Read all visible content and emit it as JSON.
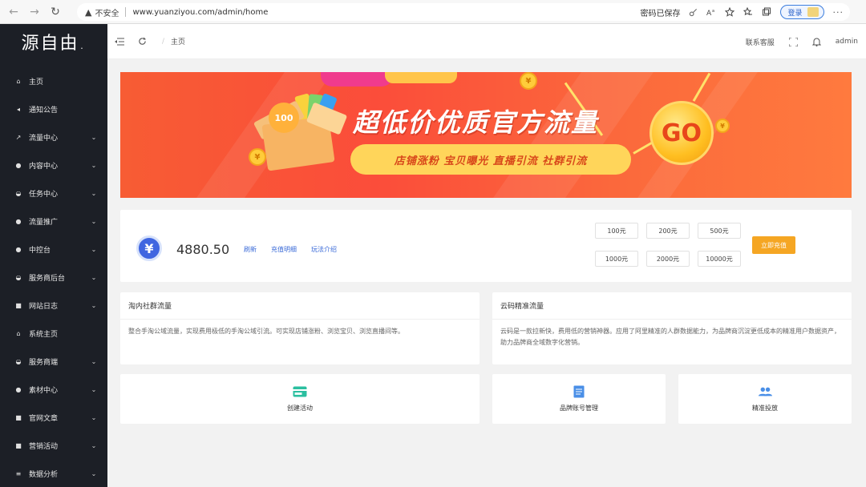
{
  "browser": {
    "back_icon": "←",
    "forward_icon": "→",
    "reload_icon": "↻",
    "security_icon": "▲",
    "security_text": "不安全",
    "url": "www.yuanziyou.com/admin/home",
    "password_saved": "密码已保存",
    "icons": [
      "key-icon",
      "read-aloud-icon",
      "favorite-add-icon",
      "favorites-icon",
      "collections-icon",
      "more-icon"
    ],
    "login_label": "登录"
  },
  "sidebar": {
    "logo": "源自由.",
    "items": [
      {
        "label": "主页",
        "icon": "home-icon",
        "glyph": "⌂",
        "chevron": false
      },
      {
        "label": "通知公告",
        "icon": "speaker-icon",
        "glyph": "◂",
        "chevron": false
      },
      {
        "label": "流量中心",
        "icon": "trend-icon",
        "glyph": "↗",
        "chevron": true
      },
      {
        "label": "内容中心",
        "icon": "content-icon",
        "glyph": "●",
        "chevron": true
      },
      {
        "label": "任务中心",
        "icon": "task-icon",
        "glyph": "◒",
        "chevron": true
      },
      {
        "label": "流量推广",
        "icon": "promote-icon",
        "glyph": "●",
        "chevron": true
      },
      {
        "label": "中控台",
        "icon": "console-icon",
        "glyph": "●",
        "chevron": true
      },
      {
        "label": "服务商后台",
        "icon": "provider-icon",
        "glyph": "◒",
        "chevron": true
      },
      {
        "label": "网站日志",
        "icon": "log-icon",
        "glyph": "■",
        "chevron": true
      },
      {
        "label": "系统主页",
        "icon": "system-home-icon",
        "glyph": "⌂",
        "chevron": false
      },
      {
        "label": "服务商端",
        "icon": "provider-end-icon",
        "glyph": "◒",
        "chevron": true
      },
      {
        "label": "素材中心",
        "icon": "material-icon",
        "glyph": "●",
        "chevron": true
      },
      {
        "label": "官网文章",
        "icon": "article-icon",
        "glyph": "■",
        "chevron": true
      },
      {
        "label": "营销活动",
        "icon": "marketing-icon",
        "glyph": "■",
        "chevron": true
      },
      {
        "label": "数据分析",
        "icon": "analytics-icon",
        "glyph": "≡",
        "chevron": true
      }
    ]
  },
  "header": {
    "breadcrumb_sep": "/",
    "breadcrumb": "主页",
    "contact": "联系客服",
    "user": "admin"
  },
  "banner": {
    "title": "超低价优质官方流量",
    "tagline": "店铺涨粉  宝贝曝光  直播引流  社群引流",
    "go": "GO",
    "coin_text": "100",
    "yen": "¥"
  },
  "balance": {
    "symbol": "¥",
    "amount": "4880.50",
    "links": [
      "刷新",
      "充值明细",
      "玩法介绍"
    ],
    "amounts_row1": [
      "100元",
      "200元",
      "500元"
    ],
    "amounts_row2": [
      "1000元",
      "2000元",
      "10000元"
    ],
    "recharge_label": "立即充值"
  },
  "info_cards": [
    {
      "title": "淘内社群流量",
      "body": "整合手淘公域流量，实现费用极低的手淘公域引流。可实现店铺涨粉、浏览宝贝、浏览直播间等。"
    },
    {
      "title": "云码精准流量",
      "body": "云码是一款拉新快，费用低的营销神器。应用了阿里精准的人群数据能力，为品牌商沉淀更低成本的精准用户数据资产，助力品牌商全域数字化营销。"
    }
  ],
  "quick_actions": [
    {
      "label": "创建活动",
      "icon": "card-icon",
      "color": "#2bbfa0"
    },
    {
      "label": "品牌账号管理",
      "icon": "document-icon",
      "color": "#4a8fe7"
    },
    {
      "label": "精准投放",
      "icon": "users-icon",
      "color": "#4a8fe7"
    }
  ],
  "colors": {
    "sidebar_bg": "#1c1f26",
    "link": "#3b6bd8",
    "recharge": "#f5a623",
    "banner_base": "#fb4d3a",
    "yen_badge": "#3f65e0"
  }
}
